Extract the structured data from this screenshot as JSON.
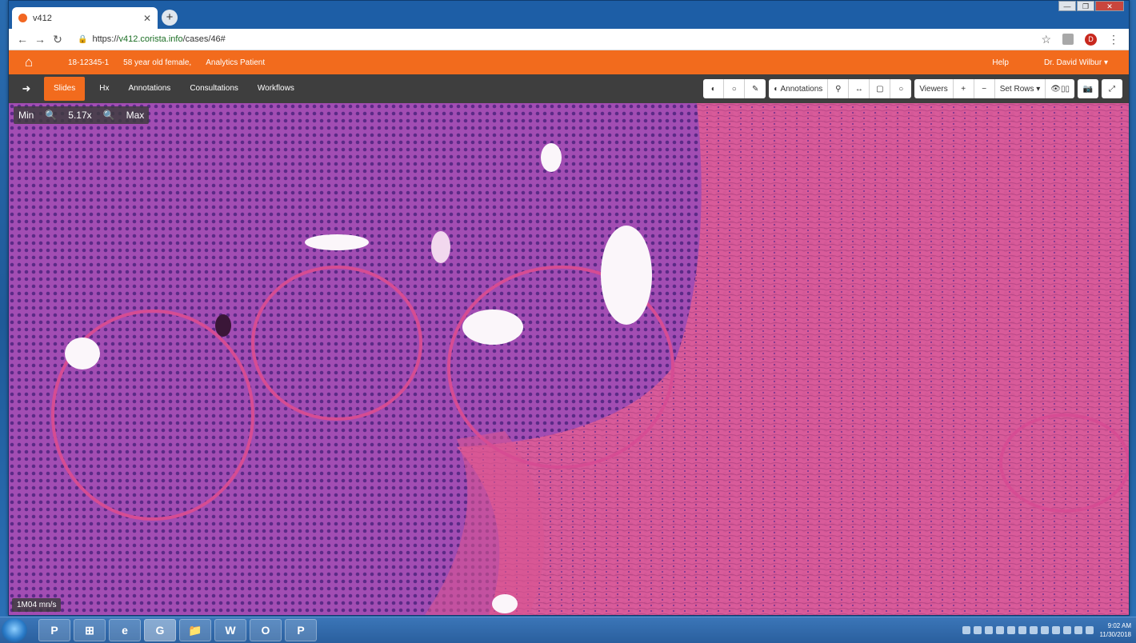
{
  "browser": {
    "tab_title": "v412",
    "new_tab": "+",
    "window_controls": [
      "—",
      "❐",
      "✕"
    ],
    "url": {
      "scheme": "https://",
      "host": "v412.corista.info",
      "path": "/cases/46#"
    },
    "icons": [
      "back-icon",
      "forward-icon",
      "reload-icon",
      "lock-icon",
      "star-icon",
      "extension-icon",
      "profile-icon",
      "menu-icon"
    ]
  },
  "app": {
    "header": {
      "case_id": "18-12345-1",
      "patient_description": "58 year old female,",
      "patient_label": "Analytics Patient",
      "help": "Help",
      "user": "Dr. David Wilbur ▾"
    },
    "toolbar": {
      "nav": [
        {
          "label": "Slides",
          "active": true
        },
        {
          "label": "Hx",
          "active": false
        },
        {
          "label": "Annotations",
          "active": false
        },
        {
          "label": "Consultations",
          "active": false
        },
        {
          "label": "Workflows",
          "active": false
        }
      ],
      "groups": {
        "adjust": [
          "◐",
          "○",
          "✎"
        ],
        "annotations": [
          "◐ Annotations",
          "⚲",
          "↔",
          "▢",
          "○"
        ],
        "viewers": [
          "Viewers",
          "+",
          "−",
          "Set Rows ▾",
          "👁▯▯"
        ],
        "tools": [
          "📷",
          "⤢"
        ]
      }
    },
    "viewer": {
      "zoom_min": "Min",
      "zoom_value": "5.17x",
      "zoom_max": "Max",
      "scale": "1M04 mn/s"
    }
  },
  "colors": {
    "accent": "#f26b1d",
    "toolbar": "#3e3e3e",
    "stain_purple": "#a44fb4",
    "stain_pink": "#e0508f"
  },
  "taskbar": {
    "apps": [
      "P",
      "⊞",
      "e",
      "G",
      "📁",
      "W",
      "O",
      "P"
    ],
    "clock_time": "9:02 AM",
    "clock_date": "11/30/2018"
  }
}
